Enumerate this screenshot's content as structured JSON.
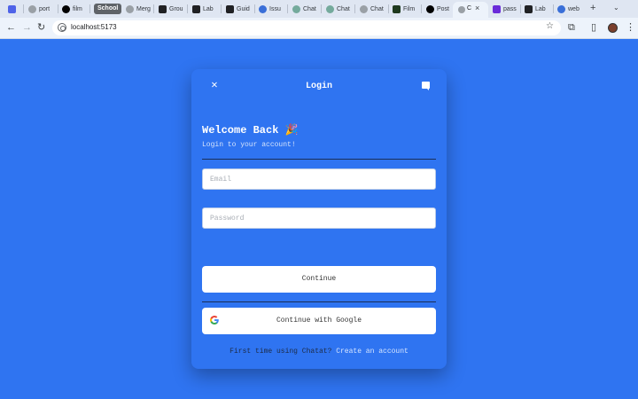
{
  "browser": {
    "tabs": [
      {
        "label": "",
        "color": "#4f63e8"
      },
      {
        "label": "port",
        "color": "#9aa0a6"
      },
      {
        "label": "film",
        "color": "#000000"
      },
      {
        "label": "School",
        "color": "#5f6368"
      },
      {
        "label": "Merg",
        "color": "#9aa0a6"
      },
      {
        "label": "Grou",
        "color": "#202124"
      },
      {
        "label": "Lab",
        "color": "#202124"
      },
      {
        "label": "Guid",
        "color": "#202124"
      },
      {
        "label": "Issu",
        "color": "#3a6fd8"
      },
      {
        "label": "Chat",
        "color": "#74aa9c"
      },
      {
        "label": "Chat",
        "color": "#74aa9c"
      },
      {
        "label": "Chat",
        "color": "#9aa0a6"
      },
      {
        "label": "Film",
        "color": "#1f3a1f"
      },
      {
        "label": "Post",
        "color": "#000000"
      },
      {
        "label": "C",
        "color": "#9aa0a6"
      },
      {
        "label": "pass",
        "color": "#6a2bd9"
      },
      {
        "label": "Lab",
        "color": "#202124"
      },
      {
        "label": "web",
        "color": "#3a6fd8"
      }
    ],
    "new_tab": "+",
    "tab_menu": "⌄",
    "url": "localhost:5173"
  },
  "login": {
    "title": "Login",
    "close_glyph": "✕",
    "welcome": "Welcome Back 🎉",
    "subtitle": "Login to your account!",
    "email_placeholder": "Email",
    "password_placeholder": "Password",
    "continue_label": "Continue",
    "google_label": "Continue with Google",
    "footer_text": "First time using Chatat?",
    "footer_link": "Create an account"
  },
  "colors": {
    "background": "#2f74f1",
    "text_dark": "#1d2b45",
    "link": "#d7e6ff"
  }
}
